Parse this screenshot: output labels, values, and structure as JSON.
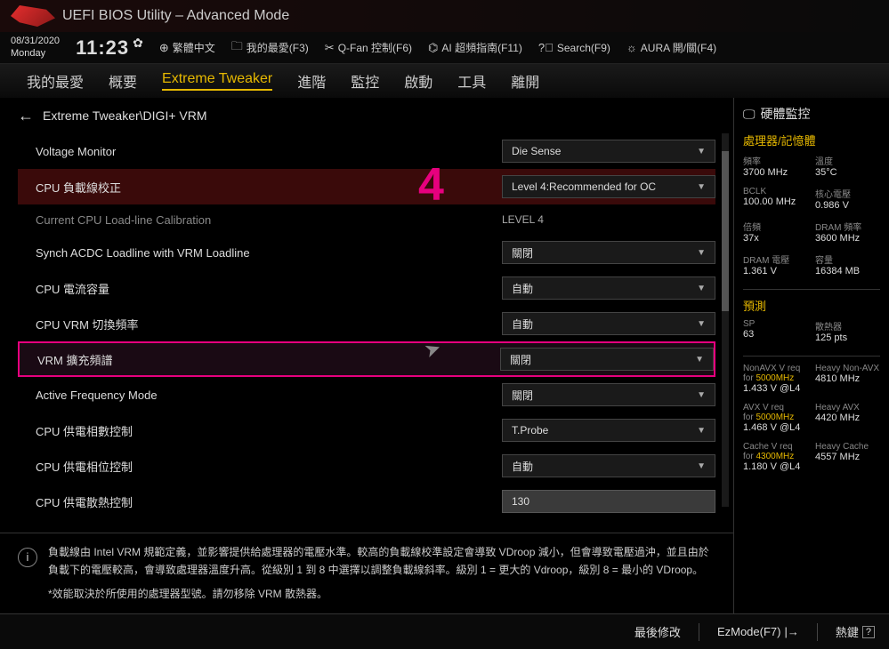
{
  "title": "UEFI BIOS Utility – Advanced Mode",
  "date": "08/31/2020",
  "day": "Monday",
  "time": "11:23",
  "toolbar": {
    "lang": "繁體中文",
    "fav": "我的最愛(F3)",
    "qfan": "Q-Fan 控制(F6)",
    "aioc": "AI 超頻指南(F11)",
    "search": "Search(F9)",
    "aura": "AURA 開/關(F4)"
  },
  "nav": {
    "fav": "我的最愛",
    "overview": "概要",
    "extreme": "Extreme Tweaker",
    "advanced": "進階",
    "monitor": "監控",
    "boot": "啟動",
    "tools": "工具",
    "exit": "離開"
  },
  "breadcrumb": "Extreme Tweaker\\DIGI+ VRM",
  "big_number": "4",
  "settings": [
    {
      "label": "Voltage Monitor",
      "value": "Die Sense",
      "type": "select"
    },
    {
      "label": "CPU 負載線校正",
      "value": "Level 4:Recommended for OC",
      "type": "select",
      "highlighted": true
    },
    {
      "label": "Current CPU Load-line Calibration",
      "value": "LEVEL 4",
      "type": "text",
      "dim": true
    },
    {
      "label": "Synch ACDC Loadline with VRM Loadline",
      "value": "關閉",
      "type": "select"
    },
    {
      "label": "CPU 電流容量",
      "value": "自動",
      "type": "select"
    },
    {
      "label": "CPU VRM 切換頻率",
      "value": "自動",
      "type": "select"
    },
    {
      "label": "VRM 擴充頻譜",
      "value": "關閉",
      "type": "select",
      "selected": true
    },
    {
      "label": "Active Frequency Mode",
      "value": "關閉",
      "type": "select"
    },
    {
      "label": "CPU 供電相數控制",
      "value": "T.Probe",
      "type": "select"
    },
    {
      "label": "CPU 供電相位控制",
      "value": "自動",
      "type": "select"
    },
    {
      "label": "CPU 供電散熱控制",
      "value": "130",
      "type": "input"
    }
  ],
  "help": {
    "line1": "負載線由 Intel VRM 規範定義，並影響提供給處理器的電壓水準。較高的負載線校準設定會導致 VDroop 減小，但會導致電壓過沖，並且由於負載下的電壓較高，會導致處理器溫度升高。從級別 1 到 8 中選擇以調整負載線斜率。級別 1 = 更大的 Vdroop，級別 8 = 最小的 VDroop。",
    "line2": "*效能取決於所使用的處理器型號。請勿移除 VRM 散熱器。"
  },
  "sidebar": {
    "title": "硬體監控",
    "cpu_section": "處理器/記憶體",
    "freq_label": "頻率",
    "freq": "3700 MHz",
    "temp_label": "溫度",
    "temp": "35°C",
    "bclk_label": "BCLK",
    "bclk": "100.00 MHz",
    "vcore_label": "核心電壓",
    "vcore": "0.986 V",
    "ratio_label": "倍頻",
    "ratio": "37x",
    "dramfreq_label": "DRAM 頻率",
    "dramfreq": "3600 MHz",
    "dramv_label": "DRAM 電壓",
    "dramv": "1.361 V",
    "cap_label": "容量",
    "cap": "16384 MB",
    "predict_section": "預測",
    "sp_label": "SP",
    "sp": "63",
    "cooler_label": "散熱器",
    "cooler": "125 pts",
    "nonavx_l1": "NonAVX V req",
    "nonavx_l2": "for",
    "nonavx_freq": "5000MHz",
    "nonavx_v": "1.433 V @L4",
    "heavy_nonavx_l": "Heavy Non-AVX",
    "heavy_nonavx": "4810 MHz",
    "avx_l1": "AVX V req",
    "avx_freq": "5000MHz",
    "avx_v": "1.468 V @L4",
    "heavy_avx_l": "Heavy AVX",
    "heavy_avx": "4420 MHz",
    "cache_l1": "Cache V req",
    "cache_freq": "4300MHz",
    "cache_v": "1.180 V @L4",
    "heavy_cache_l": "Heavy Cache",
    "heavy_cache": "4557 MHz"
  },
  "bottom": {
    "last": "最後修改",
    "ezmode": "EzMode(F7)",
    "hotkeys": "熱鍵"
  }
}
